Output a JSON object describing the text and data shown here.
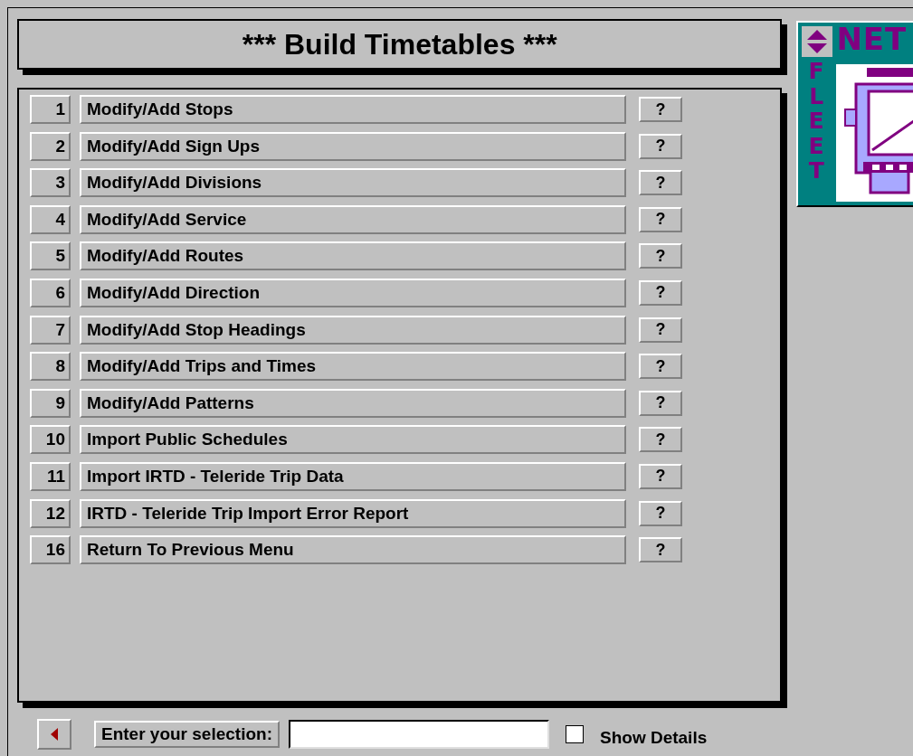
{
  "title": "*** Build Timetables ***",
  "logo": {
    "top": "NET",
    "side": "FLEET"
  },
  "menu": [
    {
      "number": "1",
      "label": "Modify/Add Stops",
      "help": "?"
    },
    {
      "number": "2",
      "label": "Modify/Add Sign Ups",
      "help": "?"
    },
    {
      "number": "3",
      "label": "Modify/Add Divisions",
      "help": "?"
    },
    {
      "number": "4",
      "label": "Modify/Add Service",
      "help": "?"
    },
    {
      "number": "5",
      "label": "Modify/Add Routes",
      "help": "?"
    },
    {
      "number": "6",
      "label": "Modify/Add Direction",
      "help": "?"
    },
    {
      "number": "7",
      "label": "Modify/Add Stop Headings",
      "help": "?"
    },
    {
      "number": "8",
      "label": "Modify/Add Trips and Times",
      "help": "?"
    },
    {
      "number": "9",
      "label": "Modify/Add Patterns",
      "help": "?"
    },
    {
      "number": "10",
      "label": "Import Public Schedules",
      "help": "?"
    },
    {
      "number": "11",
      "label": "Import IRTD - Teleride Trip Data",
      "help": "?"
    },
    {
      "number": "12",
      "label": "IRTD - Teleride Trip Import Error Report",
      "help": "?"
    },
    {
      "number": "16",
      "label": "Return To Previous Menu",
      "help": "?"
    }
  ],
  "selection": {
    "label": "Enter your selection:"
  },
  "show_details": {
    "label": "Show Details",
    "checked": false
  }
}
